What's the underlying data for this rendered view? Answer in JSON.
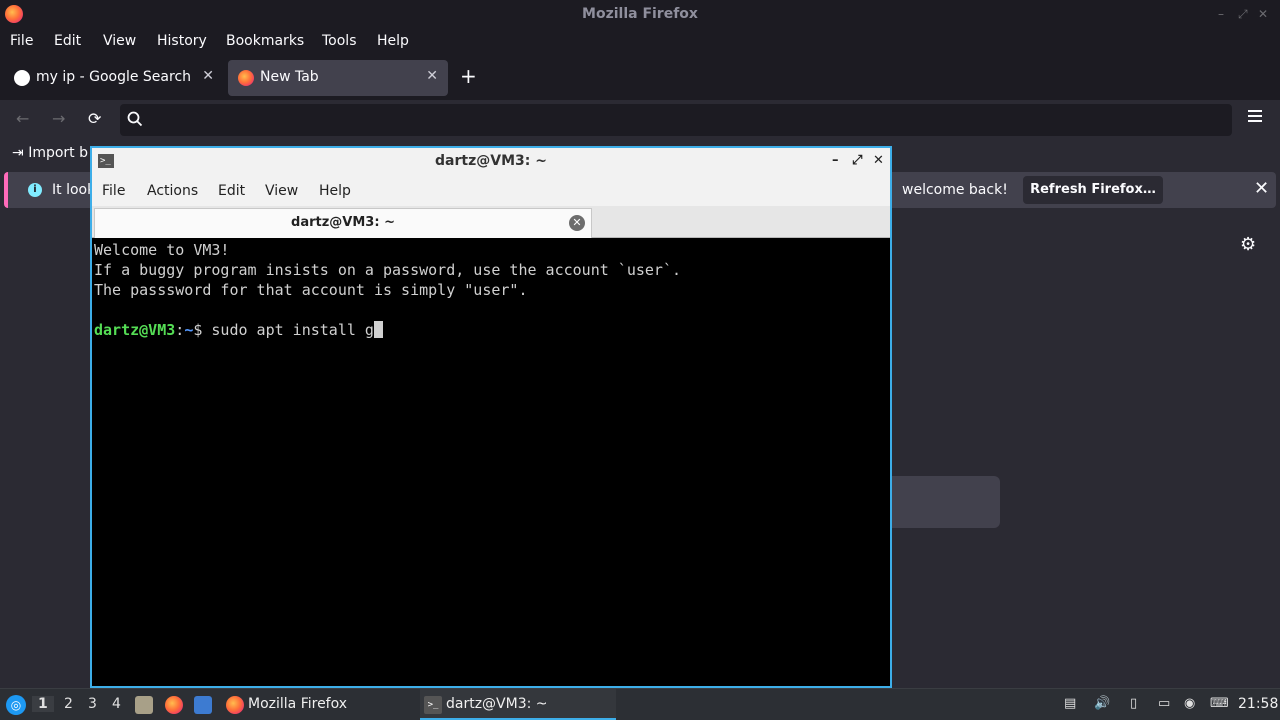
{
  "firefox": {
    "window_title": "Mozilla Firefox",
    "menu": [
      "File",
      "Edit",
      "View",
      "History",
      "Bookmarks",
      "Tools",
      "Help"
    ],
    "tabs": [
      {
        "label": "my ip - Google Search",
        "close": "✕"
      },
      {
        "label": "New Tab",
        "close": "✕"
      }
    ],
    "new_tab_symbol": "+",
    "nav": {
      "back": "←",
      "forward": "→",
      "reload": "⟳"
    },
    "urlbar": {
      "value": "",
      "placeholder": ""
    },
    "bookmarks": {
      "import_label": "Import b"
    },
    "infobar": {
      "message_start": "It looks",
      "message_end": "welcome back!",
      "button": "Refresh Firefox…",
      "close": "✕"
    },
    "settings_symbol": "⚙"
  },
  "terminal": {
    "title": "dartz@VM3: ~",
    "menu": [
      "File",
      "Actions",
      "Edit",
      "View",
      "Help"
    ],
    "tab_title": "dartz@VM3: ~",
    "tab_close": "✕",
    "controls": {
      "minimize": "–",
      "maximize": "⤢",
      "close": "✕"
    },
    "lines": [
      "Welcome to VM3!",
      "If a buggy program insists on a password, use the account `user`.",
      "The passsword for that account is simply \"user\".",
      ""
    ],
    "prompt": {
      "user_host": "dartz@VM3",
      "sep": ":",
      "path": "~",
      "symbol": "$ ",
      "command": "sudo apt install g"
    }
  },
  "taskbar": {
    "workspaces": [
      "1",
      "2",
      "3",
      "4"
    ],
    "tasks": [
      {
        "label": "Mozilla Firefox"
      },
      {
        "label": "dartz@VM3: ~"
      }
    ],
    "clock": "21:58"
  },
  "colors": {
    "accent": "#3daee9",
    "ff_bg": "#1c1b22",
    "ff_toolbar": "#2b2a33"
  }
}
